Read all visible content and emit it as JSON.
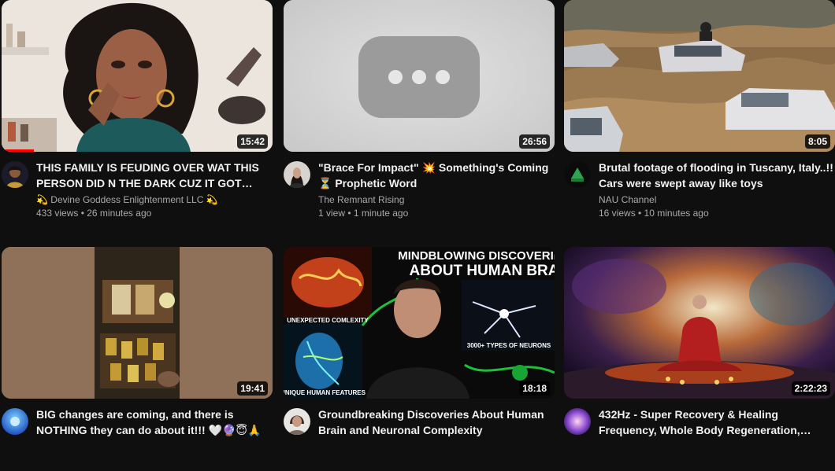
{
  "videos": [
    {
      "title": "THIS FAMILY IS FEUDING OVER WAT THIS PERSON DID N THE DARK CUZ IT GOT ALL...",
      "channel": "💫 Devine Goddess Enlightenment LLC 💫",
      "stats": "433 views • 26 minutes ago",
      "duration": "15:42",
      "progress_fraction": 0.12
    },
    {
      "title": "\"Brace For Impact\" 💥 Something's Coming ⏳ Prophetic Word",
      "channel": "The Remnant Rising",
      "stats": "1 view • 1 minute ago",
      "duration": "26:56"
    },
    {
      "title": "Brutal footage of flooding in Tuscany, Italy..!! Cars were swept away like toys",
      "channel": "NAU Channel",
      "stats": "16 views • 10 minutes ago",
      "duration": "8:05"
    },
    {
      "title": "BIG changes are coming, and there is NOTHING they can do about it!!! 🤍🔮😇🙏",
      "channel": "",
      "stats": "",
      "duration": "19:41"
    },
    {
      "title": "Groundbreaking Discoveries About Human Brain and Neuronal Complexity",
      "channel": "",
      "stats": "",
      "duration": "18:18",
      "thumb_text": {
        "headline1": "MINDBLOWING DISCOVERIES",
        "headline2": "ABOUT HUMAN BRAIN",
        "label_a": "UNEXPECTED COMLEXITY",
        "label_b": "3000+ TYPES OF NEURONS",
        "label_c": "UNIQUE HUMAN FEATURES"
      }
    },
    {
      "title": "432Hz - Super Recovery & Healing Frequency, Whole Body Regeneration, Relieve Stress -...",
      "channel": "",
      "stats": "",
      "duration": "2:22:23"
    }
  ],
  "colors": {
    "background": "#0f0f0f",
    "title": "#f1f1f1",
    "meta": "#aaaaaa",
    "progress": "#ff0000"
  },
  "icons": [
    "play-placeholder-icon"
  ]
}
